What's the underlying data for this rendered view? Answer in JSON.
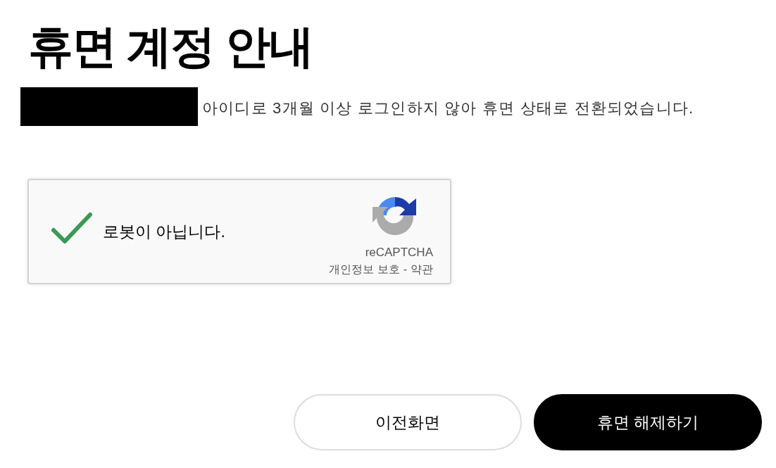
{
  "page": {
    "title": "휴면 계정 안내",
    "notice": {
      "id_redacted": true,
      "text": "아이디로 3개월 이상 로그인하지 않아 휴면 상태로 전환되었습니다."
    }
  },
  "captcha": {
    "checked": true,
    "label": "로봇이 아닙니다.",
    "brand": "reCAPTCHA",
    "links": [
      "개인정보 보호",
      "약관"
    ],
    "separator": "-"
  },
  "buttons": [
    {
      "label": "이전화면",
      "kind": "secondary"
    },
    {
      "label": "휴면 해제하기",
      "kind": "primary"
    }
  ]
}
